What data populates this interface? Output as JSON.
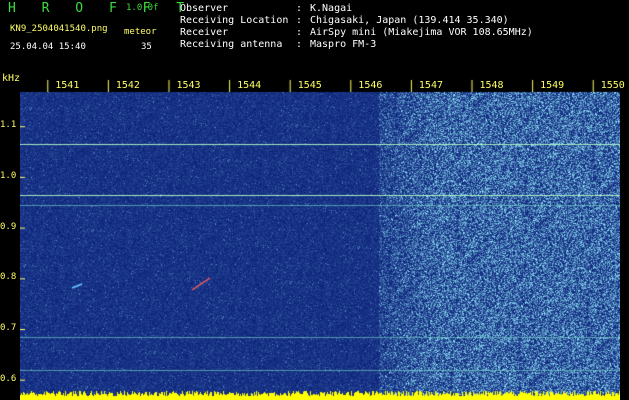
{
  "header": {
    "brand": "H R O F F T",
    "version": "1.0.0f",
    "filename": "KN9_2504041540.png",
    "mode": "meteor",
    "datetime": "25.04.04 15:40",
    "count": "35",
    "rows": [
      {
        "label": "Observer",
        "value": "K.Nagai"
      },
      {
        "label": "Receiving Location",
        "value": "Chigasaki, Japan (139.414 35.340)"
      },
      {
        "label": "Receiver",
        "value": "AirSpy mini (Miakejima VOR 108.65MHz)"
      },
      {
        "label": "Receiving antenna",
        "value": "Maspro FM-3"
      }
    ],
    "colon": ":"
  },
  "axes": {
    "y_unit": "kHz",
    "y_ticks": [
      {
        "label": "1.1",
        "value": 1.1
      },
      {
        "label": "1.0",
        "value": 1.0
      },
      {
        "label": "0.9",
        "value": 0.9
      },
      {
        "label": "0.8",
        "value": 0.8
      },
      {
        "label": "0.7",
        "value": 0.7
      },
      {
        "label": "0.6",
        "value": 0.6
      }
    ],
    "x_ticks": [
      {
        "label": "1541",
        "value": 1541
      },
      {
        "label": "1542",
        "value": 1542
      },
      {
        "label": "1543",
        "value": 1543
      },
      {
        "label": "1544",
        "value": 1544
      },
      {
        "label": "1545",
        "value": 1545
      },
      {
        "label": "1546",
        "value": 1546
      },
      {
        "label": "1547",
        "value": 1547
      },
      {
        "label": "1548",
        "value": 1548
      },
      {
        "label": "1549",
        "value": 1549
      },
      {
        "label": "1550",
        "value": 1550
      }
    ]
  },
  "colors": {
    "background": "#000000",
    "spectrum_low": "#1a2f8f",
    "spectrum_high": "#7fe0ff",
    "text_yellow": "#ffff66",
    "brand_green": "#3ddc3d",
    "baseline_yellow": "#ffff00"
  },
  "signals": [
    {
      "name": "carrier-line",
      "freq": 1.065
    },
    {
      "name": "carrier-line",
      "freq": 0.965
    },
    {
      "name": "carrier-line",
      "freq": 0.945
    },
    {
      "name": "carrier-line",
      "freq": 0.685
    },
    {
      "name": "carrier-line",
      "freq": 0.62
    }
  ]
}
